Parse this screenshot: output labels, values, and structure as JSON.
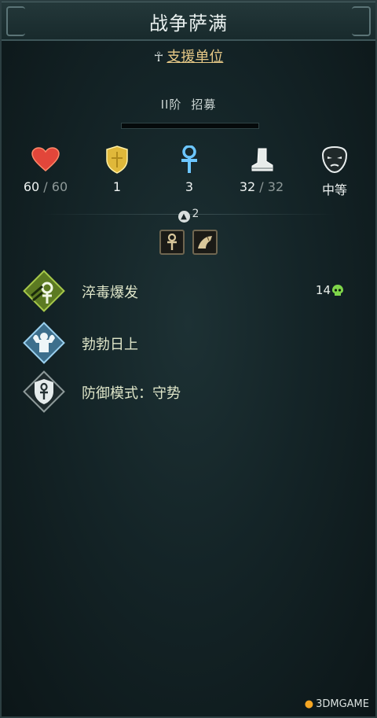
{
  "header": {
    "title": "战争萨满"
  },
  "subtitle": {
    "ankh_icon": "ankh-icon",
    "link": "支援单位"
  },
  "rank": {
    "tier": "II阶",
    "status": "招募"
  },
  "stats": {
    "health": {
      "current": "60",
      "sep": " / ",
      "max": "60",
      "icon": "heart-icon"
    },
    "armor": {
      "value": "1",
      "icon": "shield-icon"
    },
    "faith": {
      "value": "3",
      "icon": "ankh-icon"
    },
    "movement": {
      "current": "32",
      "sep": " / ",
      "max": "32",
      "icon": "boot-icon"
    },
    "morale": {
      "value": "中等",
      "icon": "mask-icon"
    }
  },
  "upgrade": {
    "count": "2"
  },
  "tags": [
    {
      "icon": "ankh-tag-icon"
    },
    {
      "icon": "beast-tag-icon"
    }
  ],
  "abilities": [
    {
      "name": "淬毒爆发",
      "cost": "14",
      "icon": "poison-burst-icon"
    },
    {
      "name": "勃勃日上",
      "icon": "strength-icon"
    },
    {
      "name": "防御模式：守势",
      "icon": "defense-ankh-icon"
    }
  ],
  "watermark": {
    "text": "3DMGAME"
  },
  "colors": {
    "accent_gold": "#e6c886",
    "poison_green": "#7fd64a",
    "faith_blue": "#6cc6ff"
  }
}
